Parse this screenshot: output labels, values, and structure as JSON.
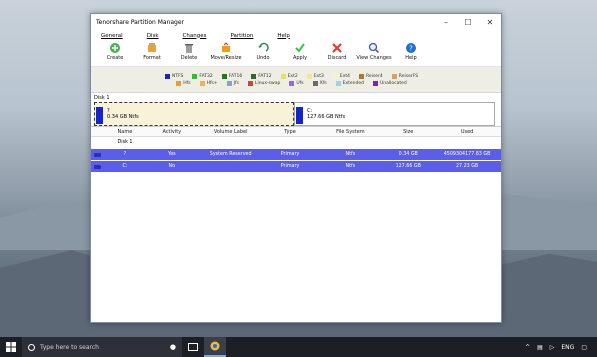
{
  "window": {
    "title": "Tenorshare Partition Manager",
    "controls": {
      "minimize": "–",
      "maximize": "☐",
      "close": "✕"
    }
  },
  "menu": [
    "General",
    "Disk",
    "Changes",
    "Partition",
    "Help"
  ],
  "toolbar": [
    {
      "label": "Create",
      "icon": "create-icon"
    },
    {
      "label": "Format",
      "icon": "format-icon"
    },
    {
      "label": "Delete",
      "icon": "delete-icon"
    },
    {
      "label": "Move/Resize",
      "icon": "move-resize-icon"
    },
    {
      "label": "Undo",
      "icon": "undo-icon"
    },
    {
      "label": "Apply",
      "icon": "apply-icon"
    },
    {
      "label": "Discard",
      "icon": "discard-icon"
    },
    {
      "label": "View Changes",
      "icon": "view-changes-icon"
    },
    {
      "label": "Help",
      "icon": "help-icon"
    }
  ],
  "legend": {
    "row1": [
      {
        "label": "NTFS",
        "color": "#1426c9"
      },
      {
        "label": "FAT32",
        "color": "#26c626"
      },
      {
        "label": "FAT16",
        "color": "#1a7a1a"
      },
      {
        "label": "FAT12",
        "color": "#2d6b2d"
      },
      {
        "label": "Ext2",
        "color": "#e8e060"
      },
      {
        "label": "Ext3",
        "color": "#f0e898"
      },
      {
        "label": "Ext4",
        "color": "#f4f0d4"
      },
      {
        "label": "Reiser4",
        "color": "#b3742f"
      },
      {
        "label": "ReiserFS",
        "color": "#d9a25a"
      }
    ],
    "row2": [
      {
        "label": "Hfs",
        "color": "#e0a040"
      },
      {
        "label": "Hfs+",
        "color": "#f0b060"
      },
      {
        "label": "Jfs",
        "color": "#8aa0c8"
      },
      {
        "label": "Linux-swap",
        "color": "#c24a3a"
      },
      {
        "label": "Ufs",
        "color": "#9a6ad0"
      },
      {
        "label": "Xfs",
        "color": "#6a6a6a"
      },
      {
        "label": "Extended",
        "color": "#a0d0e8"
      },
      {
        "label": "Unallocated",
        "color": "#7a2aa0"
      }
    ]
  },
  "disk_map": {
    "label": "Disk 1",
    "partitions": [
      {
        "name": "?",
        "size": "0.34 GB Ntfs"
      },
      {
        "name": "C:",
        "size": "127.66 GB Ntfs"
      }
    ]
  },
  "table": {
    "headers": [
      "Name",
      "Activity",
      "Volume Label",
      "Type",
      "File System",
      "Size",
      "Used"
    ],
    "disk_row": "Disk 1",
    "rows": [
      {
        "name": "?",
        "activity": "Yes",
        "volume_label": "System Reserved",
        "type": "Primary",
        "fs": "Ntfs",
        "size": "0.34 GB",
        "used": "4509304177.83 GB"
      },
      {
        "name": "C:",
        "activity": "No",
        "volume_label": "",
        "type": "Primary",
        "fs": "Ntfs",
        "size": "127.66 GB",
        "used": "27.23 GB"
      }
    ]
  },
  "taskbar": {
    "search_placeholder": "Type here to search",
    "tray_lang": "ENG",
    "tray_chevron": "^"
  }
}
